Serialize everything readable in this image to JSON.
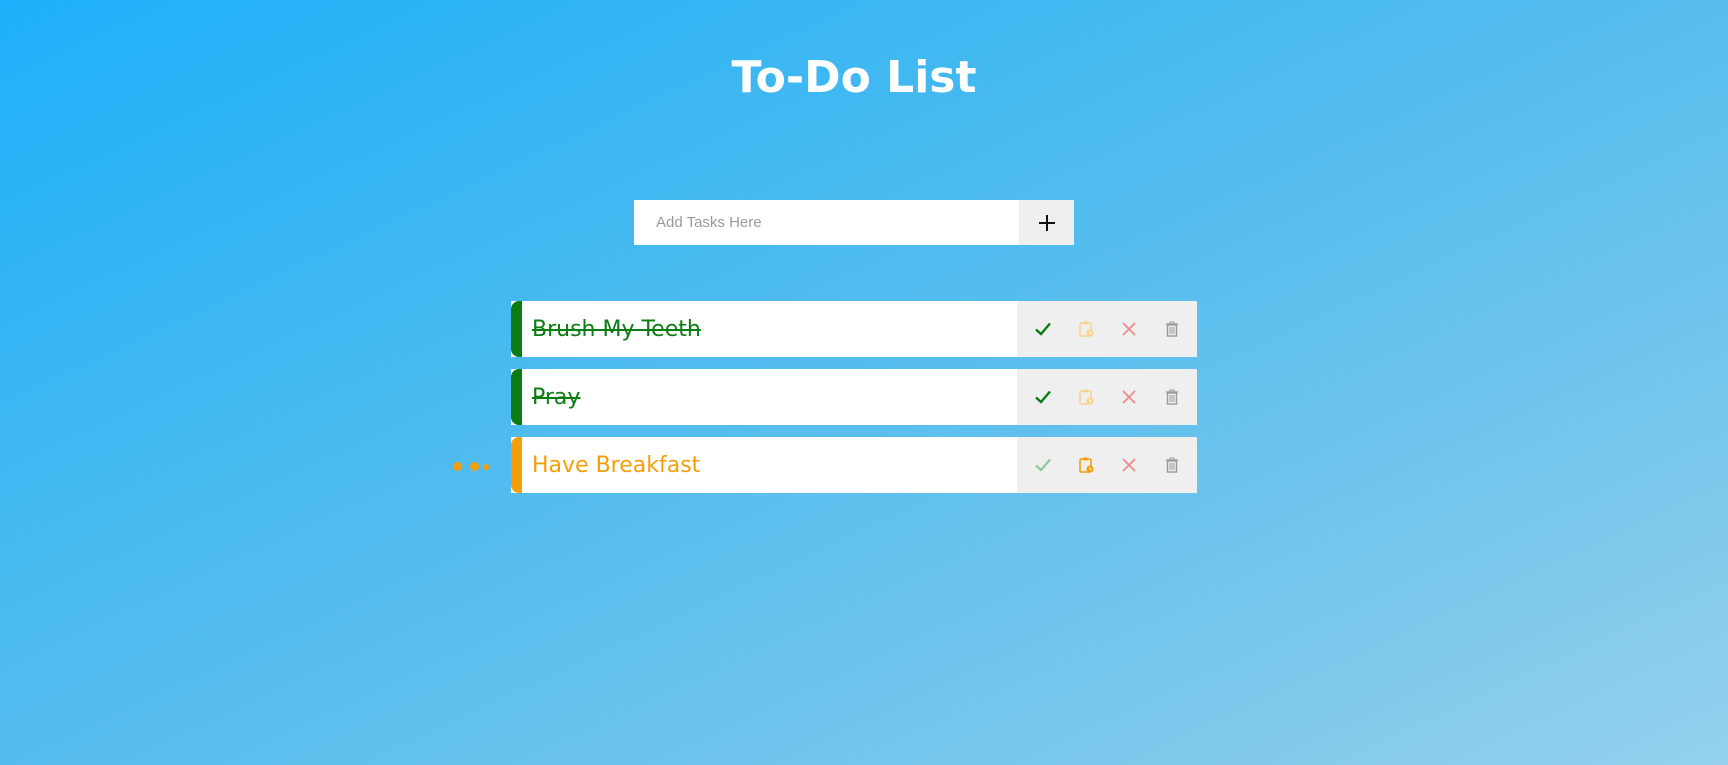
{
  "header": {
    "title": "To-Do List"
  },
  "add_task": {
    "placeholder": "Add Tasks Here",
    "value": "",
    "button_icon": "plus-icon"
  },
  "colors": {
    "done": "#0b7d12",
    "pending": "#f59e0b",
    "check_done": "#0b7d12",
    "check_inactive": "#8fc79a",
    "pending_active": "#f59e0b",
    "pending_inactive": "#f6d58c",
    "remove": "#f08a8a",
    "trash": "#9a9a9a"
  },
  "tasks": [
    {
      "label": "Brush My Teeth",
      "status": "done",
      "actions": [
        "check-icon",
        "clipboard-clock-icon",
        "close-icon",
        "trash-icon"
      ]
    },
    {
      "label": "Pray",
      "status": "done",
      "actions": [
        "check-icon",
        "clipboard-clock-icon",
        "close-icon",
        "trash-icon"
      ]
    },
    {
      "label": "Have Breakfast",
      "status": "pending",
      "actions": [
        "check-icon",
        "clipboard-clock-icon",
        "close-icon",
        "trash-icon"
      ]
    }
  ]
}
